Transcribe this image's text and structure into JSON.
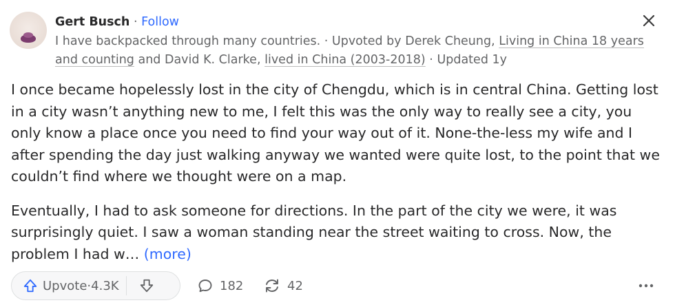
{
  "author": {
    "name": "Gert Busch",
    "separator": " · ",
    "follow_label": "Follow"
  },
  "credentials": {
    "bio": "I have backpacked through many countries.",
    "sep1": " · ",
    "upvoted_prefix": "Upvoted by ",
    "upvoter1_name": "Derek Cheung,",
    "upvoter1_cred": "Living in China 18 years and counting",
    "and": " and ",
    "upvoter2_name": "David K. Clarke,",
    "upvoter2_cred": "lived in China (2003-2018)",
    "sep2": " · ",
    "updated": "Updated 1y"
  },
  "answer": {
    "paragraph1": "I once became hopelessly lost in the city of Chengdu, which is in central China. Getting lost in a city wasn’t anything new to me, I felt this was the only way to really see a city, you only know a place once you need to find your way out of it. None-the-less my wife and I after spending the day just walking anyway we wanted were quite lost, to the point that we couldn’t find where we thought were on a map.",
    "paragraph2": "Eventually, I had to ask someone for directions. In the part of the city we were, it was surprisingly quiet. I saw a woman standing near the street waiting to cross. Now, the problem I had w…",
    "more_label": "(more)"
  },
  "actions": {
    "upvote_label": "Upvote",
    "upvote_sep": " · ",
    "upvote_count": "4.3K",
    "comments_count": "182",
    "shares_count": "42"
  },
  "colors": {
    "accent": "#2e69ff",
    "text": "#282829",
    "secondary_text": "#636466",
    "pill_bg": "#f7f7f8",
    "border": "#dee0e1"
  },
  "icons": {
    "close": "close-icon",
    "upvote": "upvote-arrow-icon",
    "downvote": "downvote-arrow-icon",
    "comment": "comment-bubble-icon",
    "share": "share-cycle-icon",
    "more": "more-dots-icon"
  }
}
